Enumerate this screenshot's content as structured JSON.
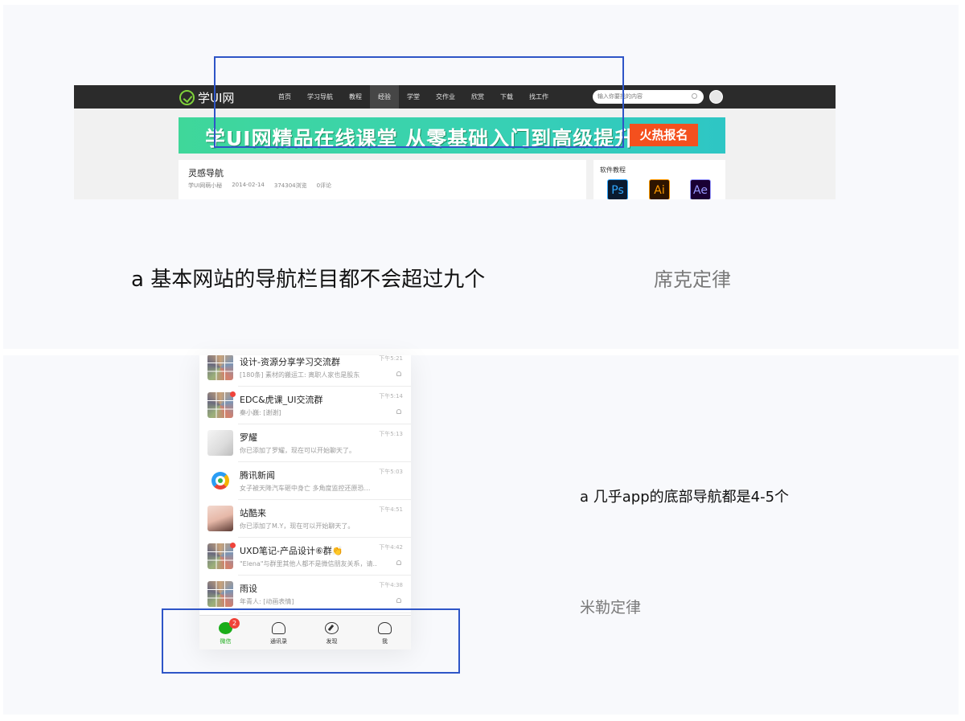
{
  "top_section": {
    "website": {
      "logo_text": "学UI网",
      "nav_items": [
        "首页",
        "学习导航",
        "教程",
        "经验",
        "学堂",
        "交作业",
        "欣赏",
        "下载",
        "找工作"
      ],
      "active_nav": "经验",
      "search_placeholder": "输入你要找的内容",
      "banner_text": "学UI网精品在线课堂  从零基础入门到高级提升",
      "banner_cta": "火热报名",
      "article_title": "灵感导航",
      "article_author": "学UI网萌小秘",
      "article_date": "2014-02-14",
      "article_views": "374304浏览",
      "article_comments": "0评论",
      "sidebar_title": "软件教程",
      "software_icons": [
        {
          "label": "Ps",
          "icon": "photoshop-icon",
          "color": "#31a8ff"
        },
        {
          "label": "Ai",
          "icon": "illustrator-icon",
          "color": "#ff9a00"
        },
        {
          "label": "Ae",
          "icon": "after-effects-icon",
          "color": "#9999ff"
        }
      ]
    },
    "caption": "a 基本网站的导航栏目都不会超过九个",
    "law": "席克定律"
  },
  "bottom_section": {
    "chats": [
      {
        "name": "设计-资源分享学习交流群",
        "preview": "[180条] 素材的搬运工: 离职人家也是股东",
        "time": "下午5:21",
        "muted": true
      },
      {
        "name": "EDC&虎课_UI交流群",
        "preview": "秦小巍: [谢谢]",
        "time": "下午5:14",
        "muted": true
      },
      {
        "name": "罗耀",
        "preview": "你已添加了罗耀，现在可以开始聊天了。",
        "time": "下午5:13",
        "muted": false
      },
      {
        "name": "腾讯新闻",
        "preview": "女子被天降汽车砸中身亡 多角度监控还原恐…",
        "time": "下午5:03",
        "muted": false
      },
      {
        "name": "站酷来",
        "preview": "你已添加了M.Y，现在可以开始聊天了。",
        "time": "下午4:51",
        "muted": false
      },
      {
        "name": "UXD笔记-产品设计⑥群👏",
        "preview": "\"Elena\"与群里其他人都不是微信朋友关系，请…",
        "time": "下午4:42",
        "muted": true
      },
      {
        "name": "雨设",
        "preview": "年青人: [动画表情]",
        "time": "下午4:38",
        "muted": true
      }
    ],
    "tabs": [
      {
        "label": "微信",
        "icon": "chat-bubble-icon",
        "badge": "2",
        "active": true
      },
      {
        "label": "通讯录",
        "icon": "contacts-icon",
        "active": false
      },
      {
        "label": "发现",
        "icon": "compass-icon",
        "active": false
      },
      {
        "label": "我",
        "icon": "person-icon",
        "active": false
      }
    ],
    "caption": "a 几乎app的底部导航都是4-5个",
    "law": "米勒定律"
  },
  "colors": {
    "highlight_box": "#2e55c7",
    "wechat_green": "#1aad19",
    "banner_green": "#3fd79a",
    "cta_orange": "#f4501e"
  }
}
